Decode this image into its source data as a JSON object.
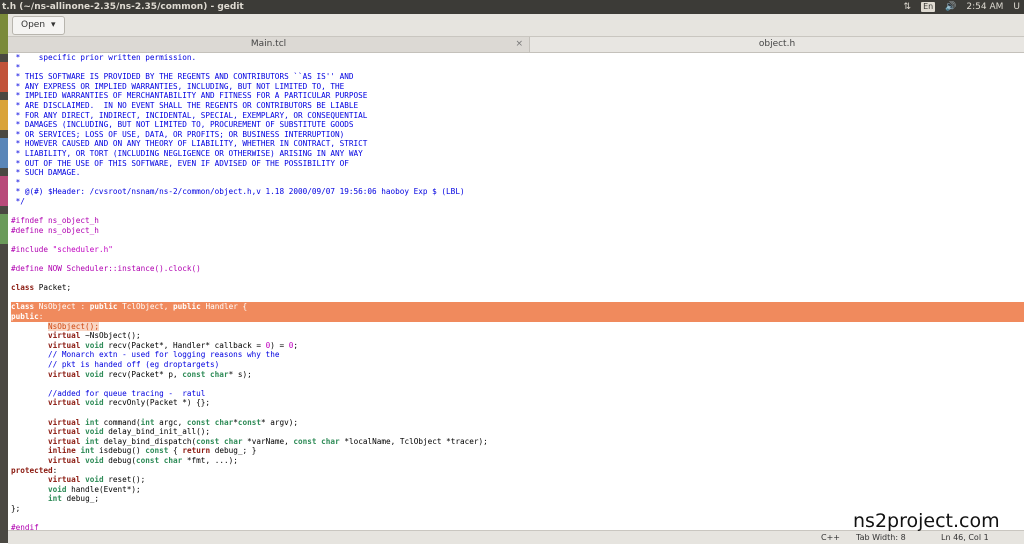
{
  "window": {
    "title": "t.h (~/ns-allinone-2.35/ns-2.35/common) - gedit",
    "clock": "2:54 AM",
    "keyboard_layout": "En",
    "user_initial": "U"
  },
  "toolbar": {
    "open_label": "Open"
  },
  "tabs": [
    {
      "label": "Main.tcl"
    },
    {
      "label": "object.h"
    }
  ],
  "status": {
    "language": "C++",
    "tab_width": "Tab Width: 8",
    "position": "Ln 46, Col 1"
  },
  "watermark": "ns2project.com",
  "colors": {
    "highlight": "#f08a5d",
    "comment": "#0000e0",
    "preprocessor": "#b000b0"
  },
  "code": [
    [
      [
        "cm",
        " *    specific prior written permission."
      ]
    ],
    [
      [
        "cm",
        " *"
      ]
    ],
    [
      [
        "cm",
        " * THIS SOFTWARE IS PROVIDED BY THE REGENTS AND CONTRIBUTORS ``AS IS'' AND"
      ]
    ],
    [
      [
        "cm",
        " * ANY EXPRESS OR IMPLIED WARRANTIES, INCLUDING, BUT NOT LIMITED TO, THE"
      ]
    ],
    [
      [
        "cm",
        " * IMPLIED WARRANTIES OF MERCHANTABILITY AND FITNESS FOR A PARTICULAR PURPOSE"
      ]
    ],
    [
      [
        "cm",
        " * ARE DISCLAIMED.  IN NO EVENT SHALL THE REGENTS OR CONTRIBUTORS BE LIABLE"
      ]
    ],
    [
      [
        "cm",
        " * FOR ANY DIRECT, INDIRECT, INCIDENTAL, SPECIAL, EXEMPLARY, OR CONSEQUENTIAL"
      ]
    ],
    [
      [
        "cm",
        " * DAMAGES (INCLUDING, BUT NOT LIMITED TO, PROCUREMENT OF SUBSTITUTE GOODS"
      ]
    ],
    [
      [
        "cm",
        " * OR SERVICES; LOSS OF USE, DATA, OR PROFITS; OR BUSINESS INTERRUPTION)"
      ]
    ],
    [
      [
        "cm",
        " * HOWEVER CAUSED AND ON ANY THEORY OF LIABILITY, WHETHER IN CONTRACT, STRICT"
      ]
    ],
    [
      [
        "cm",
        " * LIABILITY, OR TORT (INCLUDING NEGLIGENCE OR OTHERWISE) ARISING IN ANY WAY"
      ]
    ],
    [
      [
        "cm",
        " * OUT OF THE USE OF THIS SOFTWARE, EVEN IF ADVISED OF THE POSSIBILITY OF"
      ]
    ],
    [
      [
        "cm",
        " * SUCH DAMAGE."
      ]
    ],
    [
      [
        "cm",
        " *"
      ]
    ],
    [
      [
        "cm",
        " * @(#) $Header: /cvsroot/nsnam/ns-2/common/object.h,v 1.18 2000/09/07 19:56:06 haoboy Exp $ (LBL)"
      ]
    ],
    [
      [
        "cm",
        " */"
      ]
    ],
    [],
    [
      [
        "pp",
        "#ifndef ns_object_h"
      ]
    ],
    [
      [
        "pp",
        "#define ns_object_h"
      ]
    ],
    [],
    [
      [
        "pp",
        "#include "
      ],
      [
        "st",
        "\"scheduler.h\""
      ]
    ],
    [],
    [
      [
        "pp",
        "#define NOW Scheduler::instance().clock()"
      ]
    ],
    [],
    [
      [
        "kw",
        "class"
      ],
      [
        "",
        " Packet;"
      ]
    ],
    [],
    [
      [
        "hl",
        ""
      ],
      [
        "kw",
        "class"
      ],
      [
        "",
        " NsObject : "
      ],
      [
        "kw",
        "public"
      ],
      [
        "",
        " TclObject, "
      ],
      [
        "kw",
        "public"
      ],
      [
        "",
        " Handler {"
      ]
    ],
    [
      [
        "hl",
        ""
      ],
      [
        "kw",
        "public"
      ],
      [
        "",
        ":"
      ]
    ],
    [
      [
        "",
        "        "
      ],
      [
        "sel",
        "NsObject();"
      ]
    ],
    [
      [
        "",
        "        "
      ],
      [
        "kw",
        "virtual"
      ],
      [
        "",
        " ~NsObject();"
      ]
    ],
    [
      [
        "",
        "        "
      ],
      [
        "kw",
        "virtual"
      ],
      [
        "",
        " "
      ],
      [
        "ty",
        "void"
      ],
      [
        "",
        " recv(Packet*, Handler* callback = "
      ],
      [
        "nu",
        "0"
      ],
      [
        "",
        ") = "
      ],
      [
        "nu",
        "0"
      ],
      [
        "",
        ";"
      ]
    ],
    [
      [
        "",
        "        "
      ],
      [
        "cm",
        "// Monarch extn - used for logging reasons why the"
      ]
    ],
    [
      [
        "",
        "        "
      ],
      [
        "cm",
        "// pkt is handed off (eg droptargets)"
      ]
    ],
    [
      [
        "",
        "        "
      ],
      [
        "kw",
        "virtual"
      ],
      [
        "",
        " "
      ],
      [
        "ty",
        "void"
      ],
      [
        "",
        " recv(Packet* p, "
      ],
      [
        "ty",
        "const char"
      ],
      [
        "",
        "* s);"
      ]
    ],
    [],
    [
      [
        "",
        "        "
      ],
      [
        "cm",
        "//added for queue tracing -  ratul"
      ]
    ],
    [
      [
        "",
        "        "
      ],
      [
        "kw",
        "virtual"
      ],
      [
        "",
        " "
      ],
      [
        "ty",
        "void"
      ],
      [
        "",
        " recvOnly(Packet *) {};"
      ]
    ],
    [],
    [
      [
        "",
        "        "
      ],
      [
        "kw",
        "virtual"
      ],
      [
        "",
        " "
      ],
      [
        "ty",
        "int"
      ],
      [
        "",
        " command("
      ],
      [
        "ty",
        "int"
      ],
      [
        "",
        " argc, "
      ],
      [
        "ty",
        "const char"
      ],
      [
        "",
        "*"
      ],
      [
        "ty",
        "const"
      ],
      [
        "",
        "* argv);"
      ]
    ],
    [
      [
        "",
        "        "
      ],
      [
        "kw",
        "virtual"
      ],
      [
        "",
        " "
      ],
      [
        "ty",
        "void"
      ],
      [
        "",
        " delay_bind_init_all();"
      ]
    ],
    [
      [
        "",
        "        "
      ],
      [
        "kw",
        "virtual"
      ],
      [
        "",
        " "
      ],
      [
        "ty",
        "int"
      ],
      [
        "",
        " delay_bind_dispatch("
      ],
      [
        "ty",
        "const char"
      ],
      [
        "",
        " *varName, "
      ],
      [
        "ty",
        "const char"
      ],
      [
        "",
        " *localName, TclObject *tracer);"
      ]
    ],
    [
      [
        "",
        "        "
      ],
      [
        "kw",
        "inline"
      ],
      [
        "",
        " "
      ],
      [
        "ty",
        "int"
      ],
      [
        "",
        " isdebug() "
      ],
      [
        "ty",
        "const"
      ],
      [
        "",
        " { "
      ],
      [
        "kw",
        "return"
      ],
      [
        "",
        " debug_; }"
      ]
    ],
    [
      [
        "",
        "        "
      ],
      [
        "kw",
        "virtual"
      ],
      [
        "",
        " "
      ],
      [
        "ty",
        "void"
      ],
      [
        "",
        " debug("
      ],
      [
        "ty",
        "const char"
      ],
      [
        "",
        " *fmt, ...);"
      ]
    ],
    [
      [
        "kw",
        "protected"
      ],
      [
        "",
        ":"
      ]
    ],
    [
      [
        "",
        "        "
      ],
      [
        "kw",
        "virtual"
      ],
      [
        "",
        " "
      ],
      [
        "ty",
        "void"
      ],
      [
        "",
        " reset();"
      ]
    ],
    [
      [
        "",
        "        "
      ],
      [
        "ty",
        "void"
      ],
      [
        "",
        " handle(Event*);"
      ]
    ],
    [
      [
        "",
        "        "
      ],
      [
        "ty",
        "int"
      ],
      [
        "",
        " debug_;"
      ]
    ],
    [
      [
        "",
        "};"
      ]
    ],
    [],
    [
      [
        "pp",
        "#endif"
      ]
    ]
  ]
}
